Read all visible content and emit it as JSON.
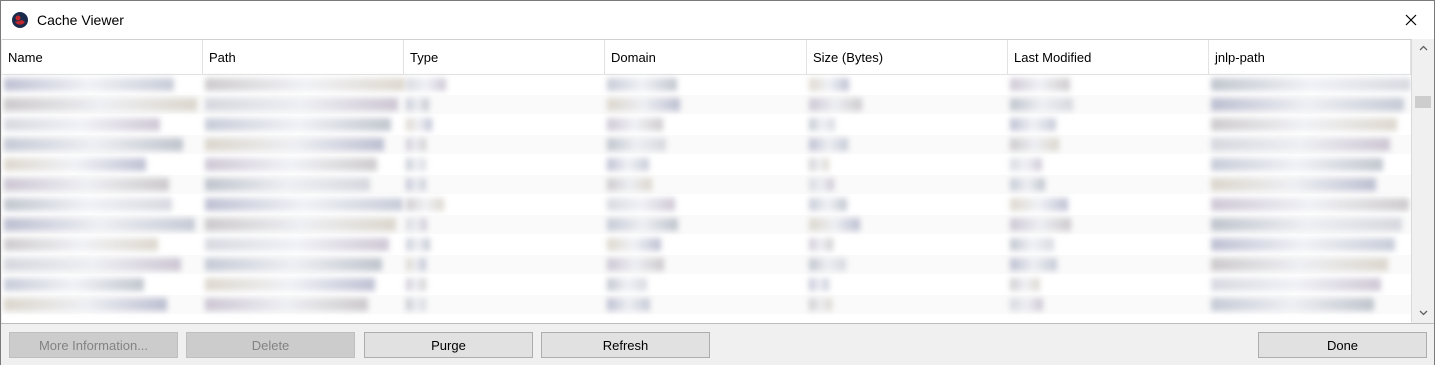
{
  "window": {
    "title": "Cache Viewer"
  },
  "table": {
    "columns": [
      "Name",
      "Path",
      "Type",
      "Domain",
      "Size (Bytes)",
      "Last Modified",
      "jnlp-path"
    ]
  },
  "buttons": {
    "more_info": "More Information...",
    "delete": "Delete",
    "purge": "Purge",
    "refresh": "Refresh",
    "done": "Done"
  },
  "colors": {
    "accent": "#c0272d",
    "icon_dark": "#1b2a4a"
  }
}
